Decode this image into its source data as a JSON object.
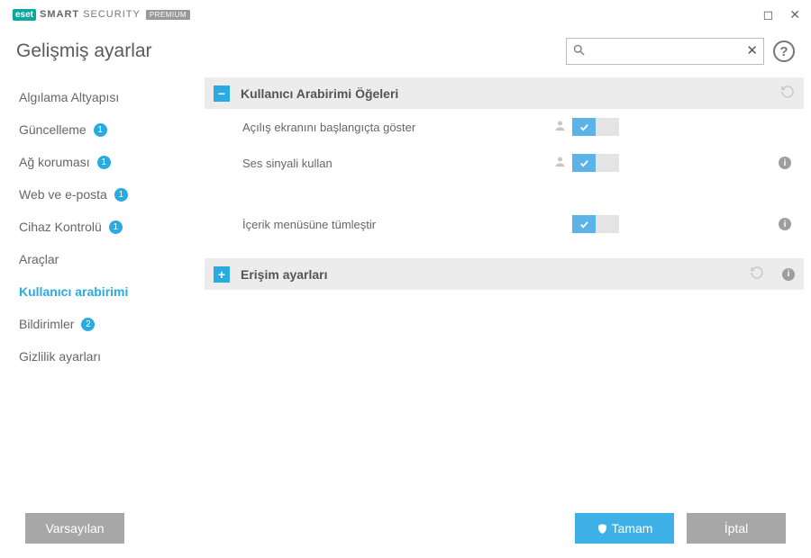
{
  "brand": {
    "badge": "eset",
    "text1": "SMART",
    "text2": "SECURITY",
    "premium": "PREMIUM"
  },
  "page_title": "Gelişmiş ayarlar",
  "search": {
    "placeholder": ""
  },
  "sidebar": {
    "items": [
      {
        "label": "Algılama Altyapısı",
        "badge": ""
      },
      {
        "label": "Güncelleme",
        "badge": "1"
      },
      {
        "label": "Ağ koruması",
        "badge": "1"
      },
      {
        "label": "Web ve e-posta",
        "badge": "1"
      },
      {
        "label": "Cihaz Kontrolü",
        "badge": "1"
      },
      {
        "label": "Araçlar",
        "badge": ""
      },
      {
        "label": "Kullanıcı arabirimi",
        "badge": ""
      },
      {
        "label": "Bildirimler",
        "badge": "2"
      },
      {
        "label": "Gizlilik ayarları",
        "badge": ""
      }
    ]
  },
  "sections": {
    "ui_elements": {
      "title": "Kullanıcı Arabirimi Öğeleri",
      "rows": [
        {
          "label": "Açılış ekranını başlangıçta göster"
        },
        {
          "label": "Ses sinyali kullan"
        },
        {
          "label": "İçerik menüsüne tümleştir"
        }
      ]
    },
    "access": {
      "title": "Erişim ayarları"
    }
  },
  "footer": {
    "default": "Varsayılan",
    "ok": "Tamam",
    "cancel": "İptal"
  }
}
